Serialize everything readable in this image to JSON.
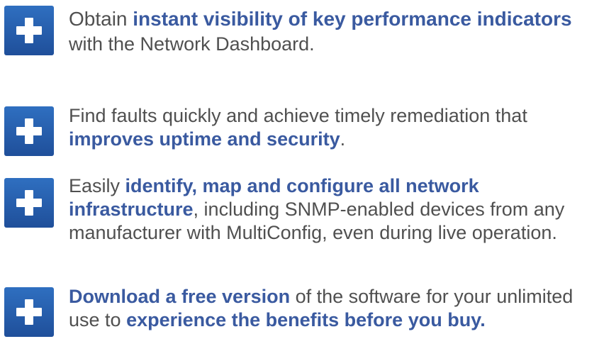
{
  "items": [
    {
      "icon": "plus-icon",
      "parts": [
        "Obtain ",
        "instant visibility of key performance indicators",
        "with the Network Dashboard."
      ]
    },
    {
      "icon": "plus-icon",
      "parts": [
        "Find faults quickly and achieve timely remediation that ",
        "improves uptime and security",
        "."
      ]
    },
    {
      "icon": "plus-icon",
      "parts": [
        "Easily ",
        "identify, map and configure all network infrastructure",
        ", including SNMP-enabled devices from any manufacturer with MultiConfig, even during live operation."
      ]
    },
    {
      "icon": "plus-icon",
      "parts": [
        "Download a free version",
        " of the software for your unlimited use to ",
        "experience the benefits before you buy."
      ]
    }
  ],
  "colors": {
    "icon": "#2a62b2",
    "highlight": "#3a5aa0",
    "text": "#505050"
  }
}
